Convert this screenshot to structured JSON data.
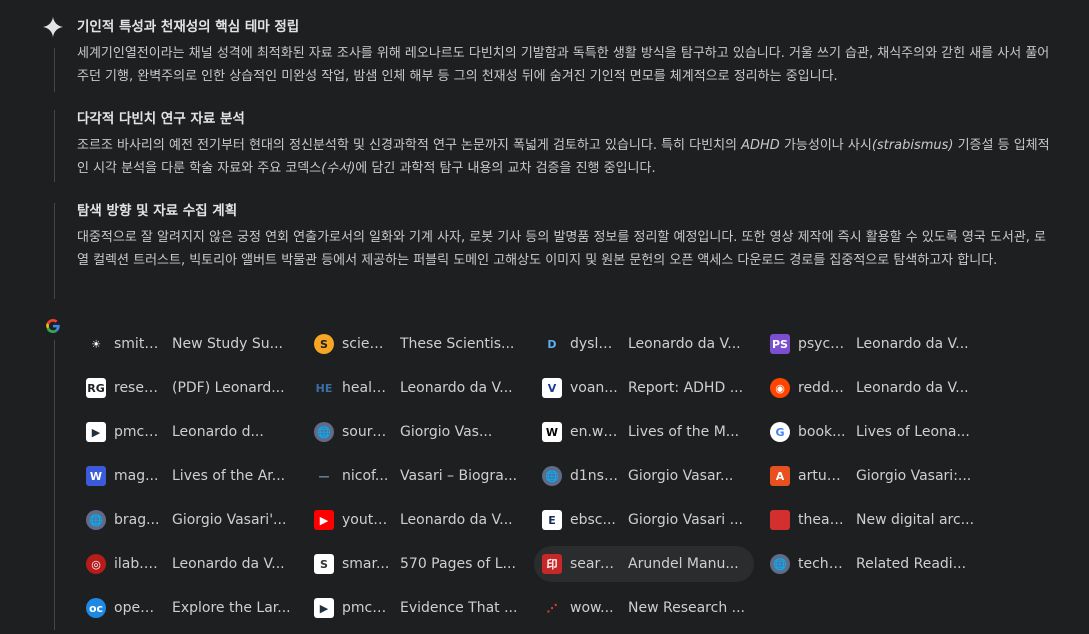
{
  "sections": [
    {
      "title": "기인적 특성과 천재성의 핵심 테마 정립",
      "body": [
        {
          "t": "세계기인열전이라는 채널 성격에 최적화된 자료 조사를 위해 레오나르도 다빈치의 기발함과 독특한 생활 방식을 탐구하고 있습니다. 거울 쓰기 습관, 채식주의와 갇힌 새를 사서 풀어주던 기행, 완벽주의로 인한 상습적인 미완성 작업, 밤샘 인체 해부 등 그의 천재성 뒤에 숨겨진 기인적 면모를 체계적으로 정리하는 중입니다."
        }
      ]
    },
    {
      "title": "다각적 다빈치 연구 자료 분석",
      "body": [
        {
          "t": "조르조 바사리의 예전 전기부터 현대의 정신분석학 및 신경과학적 연구 논문까지 폭넓게 검토하고 있습니다. 특히 다빈치의 "
        },
        {
          "t": "ADHD",
          "i": true
        },
        {
          "t": " 가능성이나 사시"
        },
        {
          "t": "(strabismus)",
          "i": true
        },
        {
          "t": " 기증설 등 입체적인 시각 분석을 다룬 학술 자료와 주요 코덱스"
        },
        {
          "t": "(수서)",
          "i": true
        },
        {
          "t": "에 담긴 과학적 탐구 내용의 교차 검증을 진행 중입니다."
        }
      ]
    },
    {
      "title": "탐색 방향 및 자료 수집 계획",
      "body": [
        {
          "t": "대중적으로 잘 알려지지 않은 궁정 연회 연출가로서의 일화와 기계 사자, 로봇 기사 등의 발명품 정보를 정리할 예정입니다. 또한 영상 제작에 즉시 활용할 수 있도록 영국 도서관, 로열 컬렉션 트러스트, 빅토리아 앨버트 박물관 등에서 제공하는 퍼블릭 도메인 고해상도 이미지 및 원본 문헌의 오픈 액세스 다운로드 경로를 집중적으로 탐색하고자 합니다."
        }
      ]
    }
  ],
  "sources": [
    {
      "domain": "smith...",
      "title": "New Study Su...",
      "icon": "smithsonian-icon",
      "bg": "#1e1f20",
      "fg": "#ffffff",
      "glyph": "☀"
    },
    {
      "domain": "scien...",
      "title": "These Scientis...",
      "icon": "sciencealert-icon",
      "bg": "#f5a623",
      "fg": "#1e1f20",
      "glyph": "S",
      "round": true
    },
    {
      "domain": "dysle...",
      "title": "Leonardo da V...",
      "icon": "dyslexia-icon",
      "bg": "#1e1f20",
      "fg": "#5ab0f0",
      "glyph": "D"
    },
    {
      "domain": "psych...",
      "title": "Leonardo da V...",
      "icon": "psychology-today-icon",
      "bg": "#7b4fd0",
      "fg": "#ffffff",
      "glyph": "PS"
    },
    {
      "domain": "resea...",
      "title": "(PDF) Leonard...",
      "icon": "researchgate-icon",
      "bg": "#ffffff",
      "fg": "#222222",
      "glyph": "RG"
    },
    {
      "domain": "healt...",
      "title": "Leonardo da V...",
      "icon": "health-icon",
      "bg": "#1e1f20",
      "fg": "#3a6ea5",
      "glyph": "HE"
    },
    {
      "domain": "voan...",
      "title": "Report: ADHD ...",
      "icon": "voa-icon",
      "bg": "#ffffff",
      "fg": "#1a3d8f",
      "glyph": "V"
    },
    {
      "domain": "reddi...",
      "title": "Leonardo da V...",
      "icon": "reddit-icon",
      "bg": "#ff4500",
      "fg": "#ffffff",
      "glyph": "◉",
      "round": true
    },
    {
      "domain": "pmc.nc...",
      "title": "Leonardo d...",
      "icon": "pmc-icon",
      "bg": "#ffffff",
      "fg": "#20303c",
      "glyph": "▶"
    },
    {
      "domain": "source...",
      "title": "Giorgio Vas...",
      "icon": "globe-icon",
      "bg": "#5f6c88",
      "fg": "#e3e3e3",
      "glyph": "🌐",
      "round": true
    },
    {
      "domain": "en.wi...",
      "title": "Lives of the M...",
      "icon": "wikipedia-icon",
      "bg": "#ffffff",
      "fg": "#000000",
      "glyph": "W"
    },
    {
      "domain": "book...",
      "title": "Lives of Leona...",
      "icon": "google-books-icon",
      "bg": "#ffffff",
      "fg": "#4285f4",
      "glyph": "G",
      "round": true
    },
    {
      "domain": "mag...",
      "title": "Lives of the Ar...",
      "icon": "wordpress-icon",
      "bg": "#3b5bdb",
      "fg": "#ffffff",
      "glyph": "W"
    },
    {
      "domain": "nicof...",
      "title": "Vasari – Biogra...",
      "icon": "nicofo-icon",
      "bg": "#1e1f20",
      "fg": "#6b8bb0",
      "glyph": "—"
    },
    {
      "domain": "d1nsv...",
      "title": "Giorgio Vasar...",
      "icon": "globe-icon",
      "bg": "#5f6c88",
      "fg": "#e3e3e3",
      "glyph": "🌐",
      "round": true
    },
    {
      "domain": "artuk...",
      "title": "Giorgio Vasari:...",
      "icon": "artuk-icon",
      "bg": "#e8501f",
      "fg": "#ffffff",
      "glyph": "A"
    },
    {
      "domain": "brag...",
      "title": "Giorgio Vasari'...",
      "icon": "globe-icon",
      "bg": "#5f6c88",
      "fg": "#e3e3e3",
      "glyph": "🌐",
      "round": true
    },
    {
      "domain": "youtu...",
      "title": "Leonardo da V...",
      "icon": "youtube-icon",
      "bg": "#ff0000",
      "fg": "#ffffff",
      "glyph": "▶"
    },
    {
      "domain": "ebsc...",
      "title": "Giorgio Vasari ...",
      "icon": "ebsco-icon",
      "bg": "#ffffff",
      "fg": "#1a2a5a",
      "glyph": "E"
    },
    {
      "domain": "thear...",
      "title": "New digital arc...",
      "icon": "theart-icon",
      "bg": "#d32f2f",
      "fg": "#d32f2f",
      "glyph": "■"
    },
    {
      "domain": "ilab.o...",
      "title": "Leonardo da V...",
      "icon": "ilab-icon",
      "bg": "#b71c1c",
      "fg": "#ffffff",
      "glyph": "◎",
      "round": true
    },
    {
      "domain": "smar...",
      "title": "570 Pages of L...",
      "icon": "smarthistory-icon",
      "bg": "#ffffff",
      "fg": "#333333",
      "glyph": "S"
    },
    {
      "domain": "searc...",
      "title": "Arundel Manu...",
      "icon": "search-archive-icon",
      "bg": "#c62828",
      "fg": "#ffffff",
      "glyph": "印",
      "active": true
    },
    {
      "domain": "teche...",
      "title": "Related Readi...",
      "icon": "globe-icon",
      "bg": "#5f6c88",
      "fg": "#e3e3e3",
      "glyph": "🌐",
      "round": true
    },
    {
      "domain": "open...",
      "title": "Explore the Lar...",
      "icon": "openculture-icon",
      "bg": "#1e88e5",
      "fg": "#ffffff",
      "glyph": "oc",
      "round": true
    },
    {
      "domain": "pmc....",
      "title": "Evidence That ...",
      "icon": "pmc-icon",
      "bg": "#ffffff",
      "fg": "#20303c",
      "glyph": "▶"
    },
    {
      "domain": "wow...",
      "title": "New Research ...",
      "icon": "wow-icon",
      "bg": "#1e1f20",
      "fg": "#e53935",
      "glyph": "⋰"
    }
  ]
}
